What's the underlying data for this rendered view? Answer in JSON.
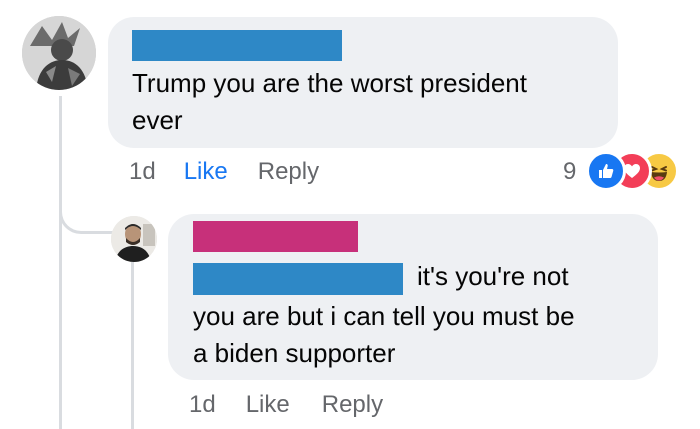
{
  "comment": {
    "text": "Trump you are the worst president ever",
    "text_line1": "Trump you are the worst president",
    "text_line2": "ever",
    "time": "1d",
    "like_label": "Like",
    "reply_label": "Reply",
    "reaction_count": "9",
    "reactions": [
      "like-icon",
      "love-icon",
      "haha-icon"
    ],
    "name_redaction_color": "#2e88c6"
  },
  "reply": {
    "text_line1": "it's you're not",
    "text_line2": "you are but i can tell you must be",
    "text_line3": "a biden supporter",
    "time": "1d",
    "like_label": "Like",
    "reply_label": "Reply",
    "name_redaction_color": "#c7307a",
    "mention_redaction_color": "#2e88c6"
  },
  "colors": {
    "bubble": "#eef0f3",
    "like_blue": "#1877f2",
    "meta_gray": "#65676b",
    "love_red": "#f33e58",
    "haha_yellow": "#f7c944"
  }
}
